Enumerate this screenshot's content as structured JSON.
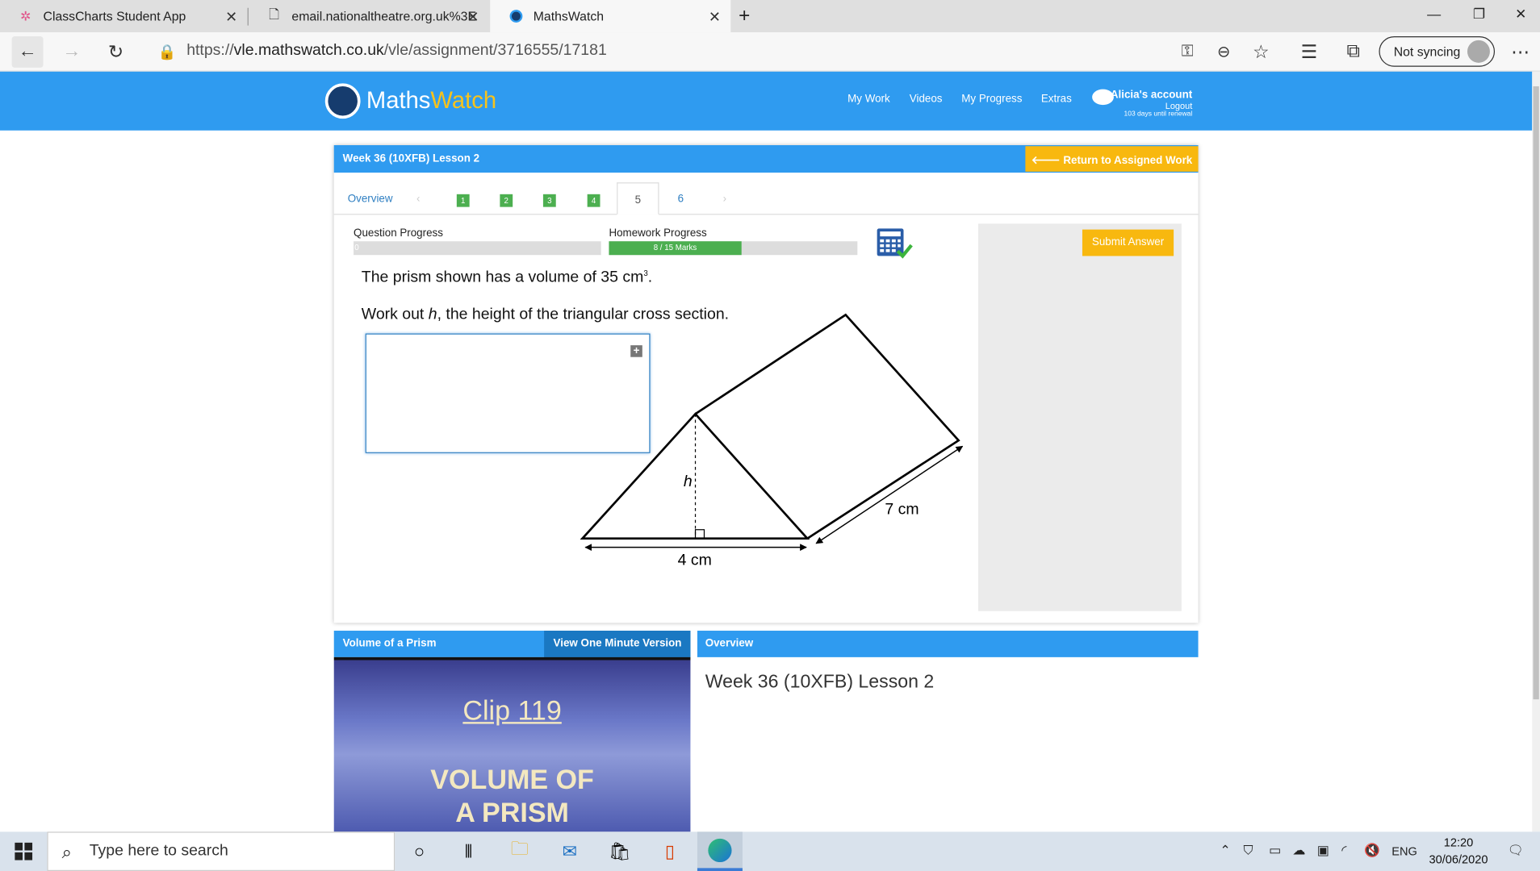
{
  "browser": {
    "tabs": [
      {
        "title": "ClassCharts Student App",
        "icon": "classcharts-star-icon"
      },
      {
        "title": "email.nationaltheatre.org.uk%3E",
        "icon": "document-icon"
      },
      {
        "title": "MathsWatch",
        "icon": "mathswatch-icon"
      }
    ],
    "url_prefix": "https://",
    "url_host": "vle.mathswatch.co.uk",
    "url_path": "/vle/assignment/3716555/17181",
    "sync_label": "Not syncing"
  },
  "site": {
    "brand_a": "Maths",
    "brand_b": "Watch",
    "nav": [
      "My Work",
      "Videos",
      "My Progress",
      "Extras"
    ],
    "account": "Alicia's account",
    "logout": "Logout",
    "renewal": "103 days until renewal"
  },
  "assignment": {
    "title": "Week 36 (10XFB) Lesson 2",
    "return_label": "Return to Assigned Work",
    "overview_tab": "Overview",
    "question_tabs": [
      "1",
      "2",
      "3",
      "4",
      "5",
      "6"
    ],
    "current_question": "5",
    "question_progress_label": "Question Progress",
    "question_progress_text": "0",
    "question_progress": 0,
    "homework_progress_label": "Homework Progress",
    "homework_progress_text": "8 / 15 Marks",
    "homework_progress": 0.533,
    "submit_label": "Submit Answer"
  },
  "question": {
    "line1_a": "The prism shown has a volume of 35 cm",
    "line1_sup": "3",
    "line1_b": ".",
    "line2_a": "Work out ",
    "line2_var": "h",
    "line2_b": ", the height of the triangular cross section.",
    "diagram_h": "h",
    "diagram_length": "7 cm",
    "diagram_base": "4 cm"
  },
  "video": {
    "title": "Volume of a Prism",
    "button": "View One Minute Version",
    "clip": "Clip 119",
    "line1": "VOLUME OF",
    "line2": "A PRISM"
  },
  "overview": {
    "title": "Overview",
    "text": "Week 36 (10XFB) Lesson 2"
  },
  "taskbar": {
    "search_placeholder": "Type here to search",
    "lang": "ENG",
    "time": "12:20",
    "date": "30/06/2020"
  }
}
